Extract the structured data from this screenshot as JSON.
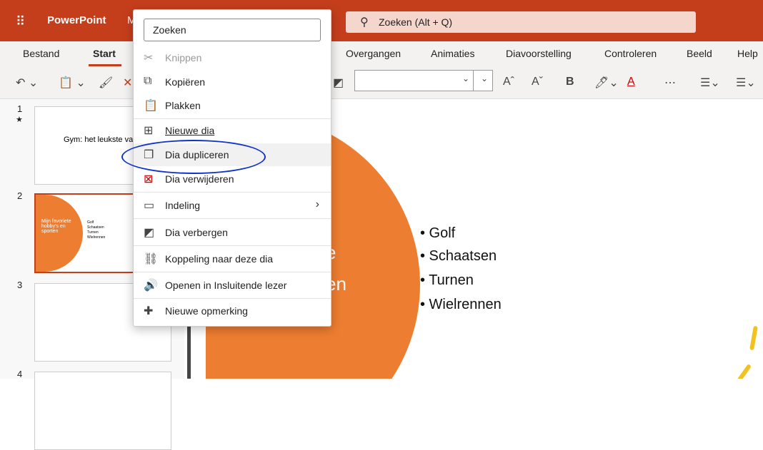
{
  "titlebar": {
    "app_name": "PowerPoint",
    "app_name_rest": "M",
    "search_text": "Zoeken (Alt + Q)"
  },
  "ribbon": {
    "tabs": [
      "Bestand",
      "Start",
      "Overgangen",
      "Animaties",
      "Diavoorstelling",
      "Controleren",
      "Beeld",
      "Help"
    ],
    "active_tab": "Start",
    "font_size_hint": "A",
    "bold_label": "B"
  },
  "slides": [
    {
      "number": "1",
      "marker": "★",
      "title": "Gym: het leukste va"
    },
    {
      "number": "2",
      "title": "Mijn favoriete hobby's en sporten",
      "bullets": [
        "Golf",
        "Schaatsen",
        "Turnen",
        "Wielrennen"
      ]
    },
    {
      "number": "3"
    },
    {
      "number": "4"
    }
  ],
  "canvas": {
    "partial_text_1": "e",
    "partial_text_2": "en",
    "bullets": [
      "• Golf",
      "• Schaatsen",
      "• Turnen",
      "• Wielrennen"
    ]
  },
  "context_menu": {
    "search_placeholder": "Zoeken",
    "items": [
      {
        "label": "Knippen",
        "icon": "✂",
        "disabled": true
      },
      {
        "label": "Kopiëren",
        "icon": "⧉"
      },
      {
        "label": "Plakken",
        "icon": "📋"
      },
      {
        "label": "Nieuwe dia",
        "icon": "⊞"
      },
      {
        "label": "Dia dupliceren",
        "icon": "❐"
      },
      {
        "label": "Dia verwijderen",
        "icon": "⊠"
      },
      {
        "label": "Indeling",
        "icon": "▭",
        "chevron": "›"
      },
      {
        "label": "Dia verbergen",
        "icon": "◩"
      },
      {
        "label": "Koppeling naar deze dia",
        "icon": "⛓"
      },
      {
        "label": "Openen in Insluitende lezer",
        "icon": "🔊"
      },
      {
        "label": "Nieuwe opmerking",
        "icon": "✚"
      }
    ]
  },
  "colors": {
    "brand": "#c43e1c",
    "slide_accent": "#ed7d31",
    "annotation": "#1133cc"
  }
}
